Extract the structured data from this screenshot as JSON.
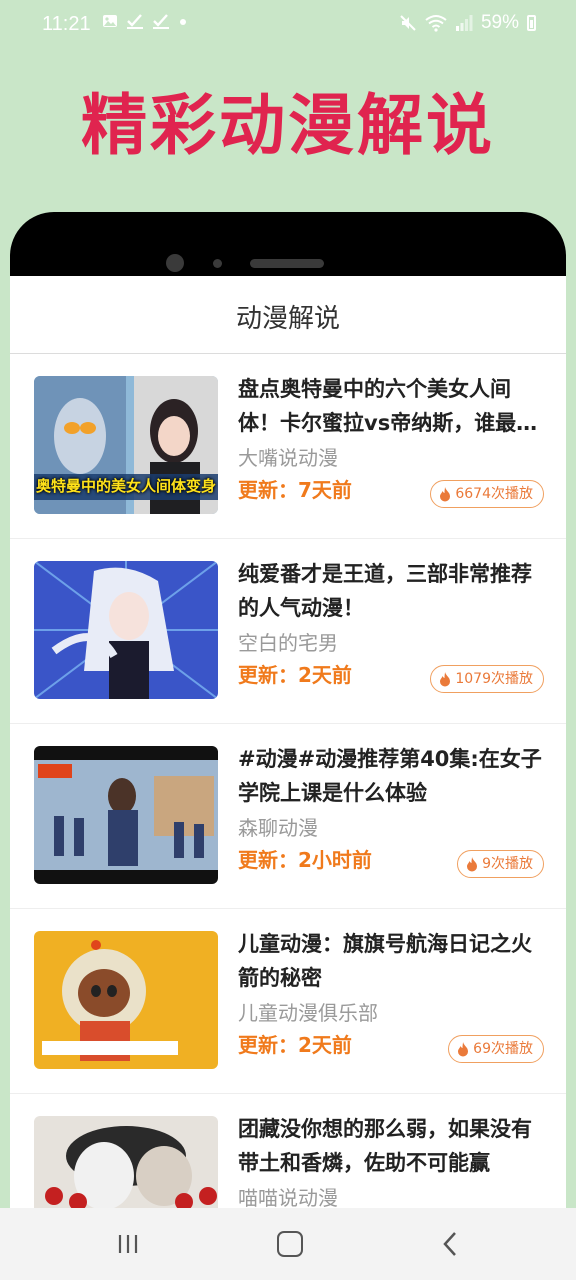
{
  "status_bar": {
    "time": "11:21",
    "battery": "59%",
    "icons_left": [
      "gallery-icon",
      "check-icon",
      "check-icon",
      "dot-icon"
    ],
    "icons_right": [
      "mute-icon",
      "wifi-icon",
      "signal-icon",
      "battery-icon"
    ]
  },
  "banner": {
    "title": "精彩动漫解说",
    "color": "#e0244f",
    "background": "#c9e6c8"
  },
  "app": {
    "header_title": "动漫解说"
  },
  "items": [
    {
      "title": "盘点奥特曼中的六个美女人间体！卡尔蜜拉vs帝纳斯，谁最…",
      "author": "大嘴说动漫",
      "update": "更新：7天前",
      "plays": "6674次播放",
      "thumb_caption": "奥特曼中的美女人间体变身"
    },
    {
      "title": "纯爱番才是王道，三部非常推荐的人气动漫！",
      "author": "空白的宅男",
      "update": "更新：2天前",
      "plays": "1079次播放",
      "thumb_caption": ""
    },
    {
      "title": "#动漫#动漫推荐第40集:在女子学院上课是什么体验",
      "author": "森聊动漫",
      "update": "更新：2小时前",
      "plays": "9次播放",
      "thumb_caption": ""
    },
    {
      "title": "儿童动漫：旗旗号航海日记之火箭的秘密",
      "author": "儿童动漫俱乐部",
      "update": "更新：2天前",
      "plays": "69次播放",
      "thumb_caption": ""
    },
    {
      "title": "团藏没你想的那么弱，如果没有带土和香燐，佐助不可能赢",
      "author": "喵喵说动漫",
      "update": "",
      "plays": "",
      "thumb_caption": ""
    }
  ],
  "colors": {
    "accent_orange": "#f07a1c",
    "badge_border": "#f0a060"
  },
  "nav": {
    "icons": [
      "recent-apps-icon",
      "home-icon",
      "back-icon"
    ]
  }
}
